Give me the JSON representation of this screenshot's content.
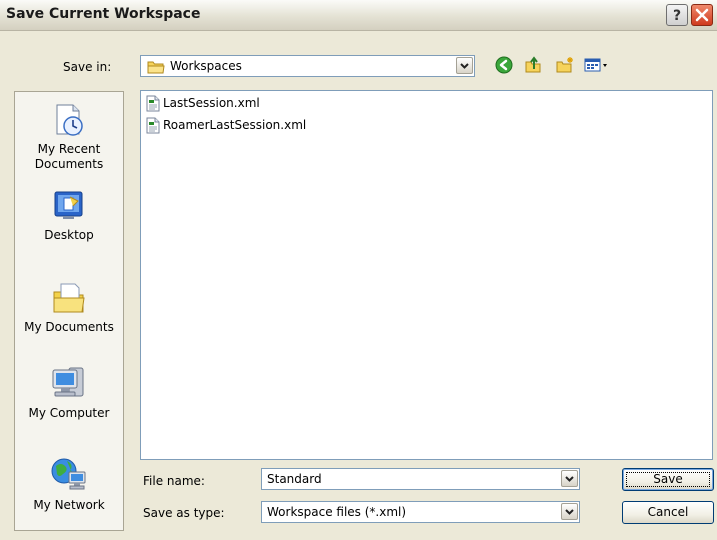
{
  "window": {
    "title": "Save Current Workspace"
  },
  "save_in": {
    "label": "Save in:",
    "value": "Workspaces"
  },
  "toolbar": {
    "icons": [
      "back-icon",
      "up-folder-icon",
      "new-folder-icon",
      "view-menu-icon"
    ]
  },
  "places": [
    {
      "label_line1": "My Recent",
      "label_line2": "Documents",
      "icon": "my-recent-documents-icon"
    },
    {
      "label_line1": "Desktop",
      "label_line2": "",
      "icon": "desktop-icon"
    },
    {
      "label_line1": "My Documents",
      "label_line2": "",
      "icon": "my-documents-icon"
    },
    {
      "label_line1": "My Computer",
      "label_line2": "",
      "icon": "my-computer-icon"
    },
    {
      "label_line1": "My Network",
      "label_line2": "",
      "icon": "my-network-icon"
    }
  ],
  "files": [
    {
      "name": "LastSession.xml",
      "icon": "xml-file-icon"
    },
    {
      "name": "RoamerLastSession.xml",
      "icon": "xml-file-icon"
    }
  ],
  "file_name": {
    "label": "File name:",
    "value": "Standard"
  },
  "save_as_type": {
    "label": "Save as type:",
    "value": "Workspace files (*.xml)"
  },
  "buttons": {
    "save": "Save",
    "cancel": "Cancel"
  }
}
